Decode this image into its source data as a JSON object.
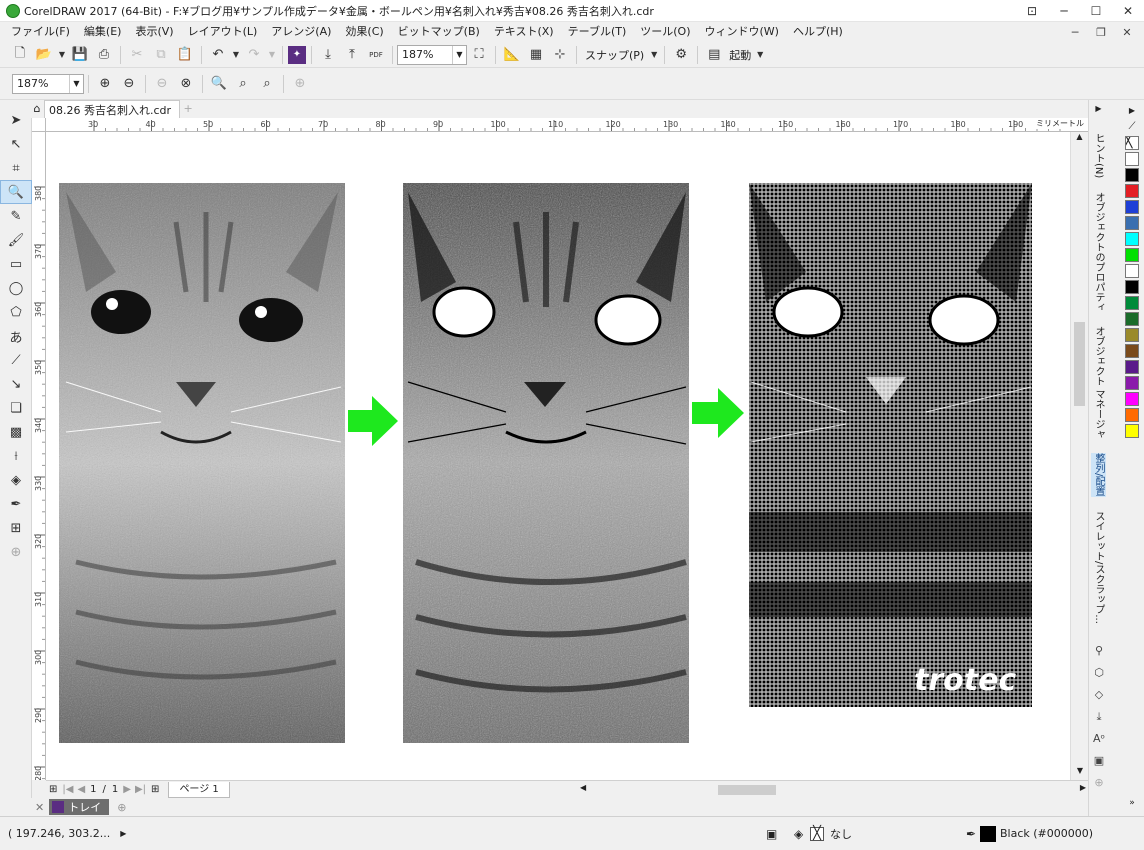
{
  "window": {
    "title": "CorelDRAW 2017 (64-Bit) - F:¥ブログ用¥サンプル作成データ¥金属・ボールペン用¥名刺入れ¥秀吉¥08.26 秀吉名刺入れ.cdr"
  },
  "menu": [
    "ファイル(F)",
    "編集(E)",
    "表示(V)",
    "レイアウト(L)",
    "アレンジ(A)",
    "効果(C)",
    "ビットマップ(B)",
    "テキスト(X)",
    "テーブル(T)",
    "ツール(O)",
    "ウィンドウ(W)",
    "ヘルプ(H)"
  ],
  "toolbar": {
    "zoom_value": "187%",
    "snap_label": "スナップ(P)",
    "launch_label": "起動",
    "pdf_label": "PDF"
  },
  "property_bar": {
    "zoom_value": "187%"
  },
  "document_tab": {
    "label": "08.26 秀吉名刺入れ.cdr"
  },
  "ruler": {
    "h_ticks": [
      "30",
      "40",
      "50",
      "60",
      "70",
      "80",
      "90",
      "100",
      "110",
      "120",
      "130",
      "140",
      "150",
      "160",
      "170",
      "180",
      "190"
    ],
    "v_ticks": [
      "380",
      "370",
      "360",
      "350",
      "340",
      "330",
      "320",
      "310",
      "300",
      "290",
      "280"
    ],
    "unit": "ミリメートル"
  },
  "canvas": {
    "logo_text": "trotec",
    "arrow_color": "#1ee81e"
  },
  "page_nav": {
    "current": "1",
    "separator": "/",
    "total": "1",
    "page_tab": "ページ 1"
  },
  "tray": {
    "label": "トレイ"
  },
  "status": {
    "coords": "( 197.246, 303.2...",
    "fill_label": "なし",
    "outline_label": "Black (#000000)"
  },
  "dockers": [
    "ヒント(N)",
    "オブジェクトのプロパティ",
    "オブジェクト マネージャ",
    "整列/配置",
    "スイレット/スクラップ..."
  ],
  "palette_colors": [
    "#ffffff",
    "#000000",
    "#e31e24",
    "#1e3fd6",
    "#3a6fb0",
    "#00ffff",
    "#00e000",
    "#ffffff",
    "#000000",
    "#008b3a",
    "#1a6b2a",
    "#9a8a2a",
    "#7a4a1a",
    "#5a1a8a",
    "#8a1aaa",
    "#ff00ff",
    "#ff6a00",
    "#ffff00"
  ]
}
